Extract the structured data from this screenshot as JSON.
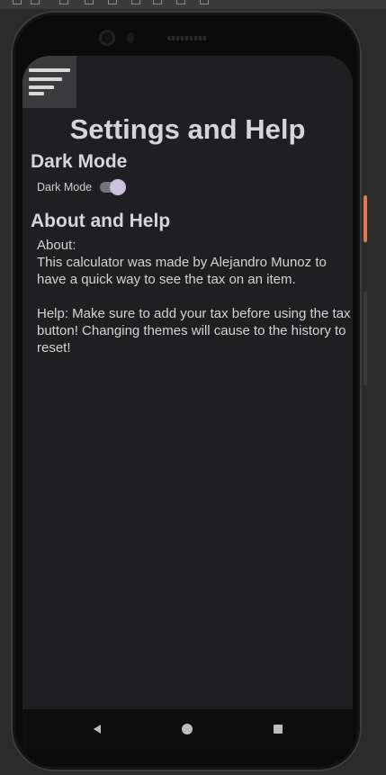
{
  "colors": {
    "screen_background": "#1f1f21",
    "heading_text": "#d6d6da",
    "toggle_thumb": "#cdc2de",
    "toggle_track": "#75727d",
    "volume_accent": "#e0785a"
  },
  "icons": {
    "menu": "hamburger-menu-icon",
    "back": "back-triangle-icon",
    "home": "home-circle-icon",
    "recents": "recents-square-icon"
  },
  "page": {
    "title": "Settings and Help"
  },
  "dark_mode": {
    "heading": "Dark Mode",
    "toggle_label": "Dark Mode",
    "enabled": true
  },
  "about_help": {
    "heading": "About and Help",
    "about_label": "About:",
    "about_text": "This calculator was made by Alejandro Munoz to have a quick way to see the tax on an item.",
    "help_text": "Help: Make sure to add your tax before using the tax button! Changing themes will cause to the history to reset!"
  }
}
